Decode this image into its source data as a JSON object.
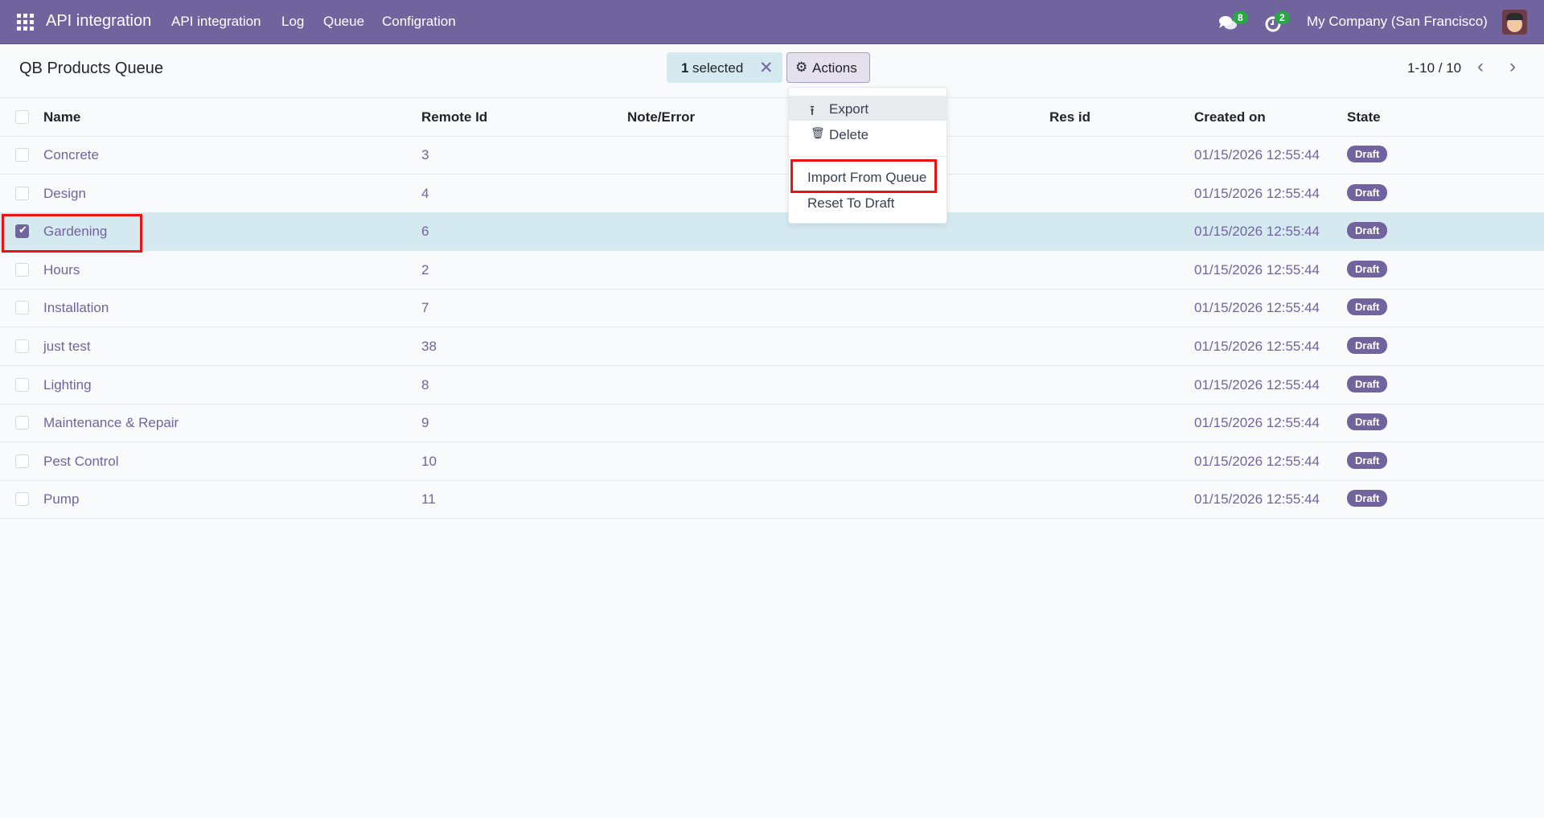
{
  "navbar": {
    "app_name": "API integration",
    "menu": [
      "API integration",
      "Log",
      "Queue",
      "Configration"
    ],
    "messages_count": "8",
    "activities_count": "2",
    "company": "My Company (San Francisco)"
  },
  "control_panel": {
    "title": "QB Products Queue",
    "selected_count": "1",
    "selected_label": "selected",
    "actions_label": "Actions",
    "pager": "1-10 / 10"
  },
  "actions_menu": {
    "items": [
      "Export",
      "Delete",
      "Import From Queue",
      "Reset To Draft"
    ]
  },
  "table": {
    "columns": [
      "Name",
      "Remote Id",
      "Note/Error",
      "Res id",
      "Created on",
      "State"
    ],
    "rows": [
      {
        "name": "Concrete",
        "remote_id": "3",
        "created": "01/15/2026 12:55:44",
        "state": "Draft",
        "selected": false
      },
      {
        "name": "Design",
        "remote_id": "4",
        "created": "01/15/2026 12:55:44",
        "state": "Draft",
        "selected": false
      },
      {
        "name": "Gardening",
        "remote_id": "6",
        "created": "01/15/2026 12:55:44",
        "state": "Draft",
        "selected": true
      },
      {
        "name": "Hours",
        "remote_id": "2",
        "created": "01/15/2026 12:55:44",
        "state": "Draft",
        "selected": false
      },
      {
        "name": "Installation",
        "remote_id": "7",
        "created": "01/15/2026 12:55:44",
        "state": "Draft",
        "selected": false
      },
      {
        "name": "just test",
        "remote_id": "38",
        "created": "01/15/2026 12:55:44",
        "state": "Draft",
        "selected": false
      },
      {
        "name": "Lighting",
        "remote_id": "8",
        "created": "01/15/2026 12:55:44",
        "state": "Draft",
        "selected": false
      },
      {
        "name": "Maintenance & Repair",
        "remote_id": "9",
        "created": "01/15/2026 12:55:44",
        "state": "Draft",
        "selected": false
      },
      {
        "name": "Pest Control",
        "remote_id": "10",
        "created": "01/15/2026 12:55:44",
        "state": "Draft",
        "selected": false
      },
      {
        "name": "Pump",
        "remote_id": "11",
        "created": "01/15/2026 12:55:44",
        "state": "Draft",
        "selected": false
      }
    ]
  },
  "colors": {
    "brand": "#71639e",
    "selected_row": "#d4eaf0",
    "badge": "#28a745",
    "highlight": "#ee1111"
  }
}
